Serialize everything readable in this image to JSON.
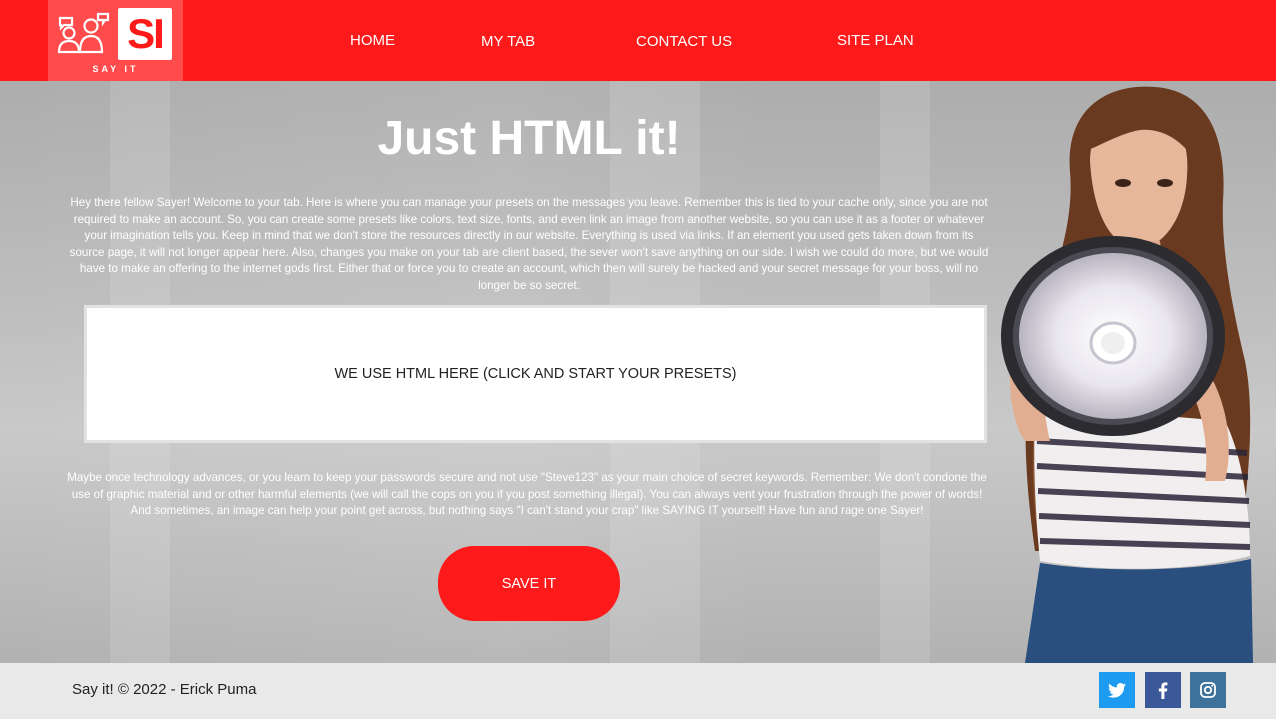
{
  "logo": {
    "monogram": "SI",
    "tagline": "SAY IT"
  },
  "nav": {
    "home": "HOME",
    "my_tab": "MY TAB",
    "contact": "CONTACT US",
    "site_plan": "SITE PLAN"
  },
  "main": {
    "title": "Just HTML it!",
    "intro": "Hey there fellow Sayer! Welcome to your tab. Here is where you can manage your presets on the messages you leave. Remember this is tied to your cache only, since you are not required to make an account. So, you can create some presets like colors, text size, fonts, and even link an image from another website, so you can use it as a footer or whatever your imagination tells you. Keep in mind that we don't store the resources directly in our website. Everything is used via links. If an element you used gets taken down from its source page, it will not longer appear here. Also, changes you make on your tab are client based, the sever won't save anything on our side. I wish we could do more, but we would have to make an offering to the internet gods first. Either that or force you to create an account, which then will surely be hacked and your secret message for your boss, will no longer be so secret.",
    "editor_label": "WE USE HTML HERE (CLICK AND START YOUR PRESETS)",
    "outro": "Maybe once technology advances, or you learn to keep your passwords secure and not use \"Steve123\" as your main choice of secret keywords. Remember: We don't condone the use of graphic material and or other harmful elements (we will call the cops on you if you post something illegal). You can always vent your frustration through the power of words! And sometimes, an image can help your point get across, but nothing says \"I can't stand your crap\" like SAYING IT yourself! Have fun and rage one Sayer!",
    "save_label": "SAVE IT"
  },
  "footer": {
    "copyright": "Say it! © 2022 - Erick Puma",
    "social": [
      {
        "icon": "twitter-icon",
        "color": "#1d9bf0"
      },
      {
        "icon": "facebook-icon",
        "color": "#3b5998"
      },
      {
        "icon": "instagram-icon",
        "color": "#3f729b"
      }
    ]
  },
  "colors": {
    "brand_red": "#fe1a1a",
    "footer_bg": "#e9e9e9"
  }
}
